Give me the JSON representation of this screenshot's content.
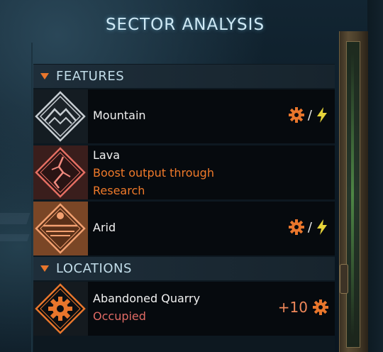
{
  "title": "SECTOR ANALYSIS",
  "features_header": "FEATURES",
  "locations_header": "LOCATIONS",
  "features": [
    {
      "name": "Mountain",
      "icon": "mountain-icon",
      "yield_separator": "/"
    },
    {
      "name": "Lava",
      "icon": "lava-icon",
      "note_line1": "Boost output through",
      "note_line2": "Research"
    },
    {
      "name": "Arid",
      "icon": "arid-icon",
      "yield_separator": "/"
    }
  ],
  "locations": [
    {
      "name": "Abandoned Quarry",
      "status": "Occupied",
      "icon": "gear-icon",
      "bonus": "+10"
    }
  ],
  "colors": {
    "accent_orange": "#f07a2a",
    "energy_yellow": "#e6d43a",
    "occupied_red": "#e06a64",
    "lava_bg": "#3a1e1c",
    "arid_bg": "#7a4626"
  }
}
